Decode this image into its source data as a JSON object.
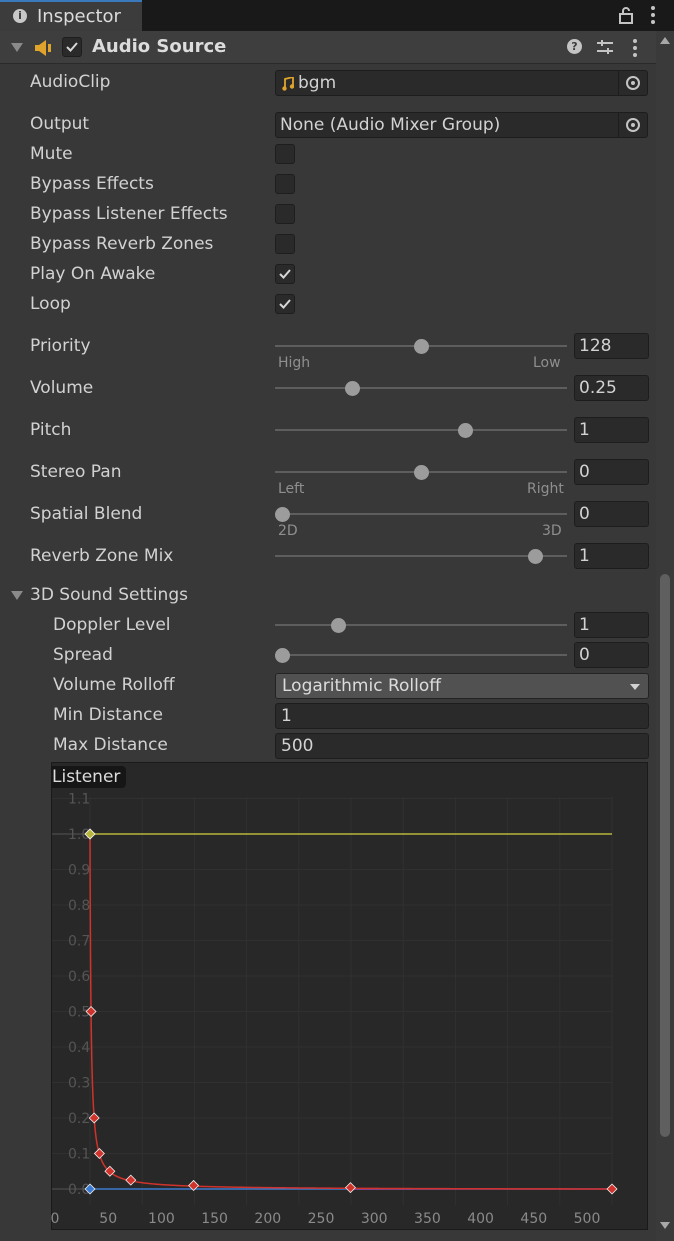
{
  "window": {
    "tab_title": "Inspector"
  },
  "component": {
    "title": "Audio Source",
    "enabled": true
  },
  "fields": {
    "audioclip": {
      "label": "AudioClip",
      "value": "bgm"
    },
    "output": {
      "label": "Output",
      "value": "None (Audio Mixer Group)"
    },
    "mute": {
      "label": "Mute",
      "checked": false
    },
    "bypass_effects": {
      "label": "Bypass Effects",
      "checked": false
    },
    "bypass_listener_effects": {
      "label": "Bypass Listener Effects",
      "checked": false
    },
    "bypass_reverb_zones": {
      "label": "Bypass Reverb Zones",
      "checked": false
    },
    "play_on_awake": {
      "label": "Play On Awake",
      "checked": true
    },
    "loop": {
      "label": "Loop",
      "checked": true
    }
  },
  "sliders": {
    "priority": {
      "label": "Priority",
      "value": "128",
      "fraction": 0.5,
      "left_caption": "High",
      "right_caption": "Low"
    },
    "volume": {
      "label": "Volume",
      "value": "0.25",
      "fraction": 0.25
    },
    "pitch": {
      "label": "Pitch",
      "value": "1",
      "fraction": 0.657
    },
    "stereo_pan": {
      "label": "Stereo Pan",
      "value": "0",
      "fraction": 0.5,
      "left_caption": "Left",
      "right_caption": "Right"
    },
    "spatial_blend": {
      "label": "Spatial Blend",
      "value": "0",
      "fraction": 0.0,
      "left_caption": "2D",
      "right_caption": "3D"
    },
    "reverb_zone_mix": {
      "label": "Reverb Zone Mix",
      "value": "1",
      "fraction": 0.9091
    }
  },
  "sound3d": {
    "title": "3D Sound Settings",
    "doppler_level": {
      "label": "Doppler Level",
      "value": "1",
      "fraction": 0.2
    },
    "spread": {
      "label": "Spread",
      "value": "0",
      "fraction": 0.0
    },
    "volume_rolloff": {
      "label": "Volume Rolloff",
      "value": "Logarithmic Rolloff"
    },
    "min_distance": {
      "label": "Min Distance",
      "value": "1"
    },
    "max_distance": {
      "label": "Max Distance",
      "value": "500"
    }
  },
  "curve": {
    "listener_label": "Listener",
    "y_ticks": [
      "0.0",
      "0.1",
      "0.2",
      "0.3",
      "0.4",
      "0.5",
      "0.6",
      "0.7",
      "0.8",
      "0.9",
      "1.0",
      "1.1"
    ],
    "x_ticks": [
      "0",
      "50",
      "100",
      "150",
      "200",
      "250",
      "300",
      "350",
      "400",
      "450",
      "500"
    ],
    "colors": {
      "volume": "#d0332b",
      "spatial": "#b8b63a",
      "spread": "#3a7ad0",
      "reverb": "#9c4fc2"
    },
    "chart_data": {
      "type": "line",
      "xlim": [
        0,
        500
      ],
      "ylim": [
        0,
        1.1
      ],
      "series": [
        {
          "x": [
            1,
            2,
            5,
            10,
            20,
            40,
            100,
            250,
            500
          ],
          "y": [
            1.0,
            0.5,
            0.2,
            0.1,
            0.05,
            0.025,
            0.01,
            0.004,
            0.0
          ]
        },
        {
          "x": [
            1,
            500
          ],
          "y": [
            1.0,
            1.0
          ]
        },
        {
          "x": [
            1,
            500
          ],
          "y": [
            0.0,
            0.0
          ]
        }
      ],
      "keys": [
        {
          "x": 1,
          "y": 1.0
        },
        {
          "x": 2,
          "y": 0.5
        },
        {
          "x": 5,
          "y": 0.2
        },
        {
          "x": 10,
          "y": 0.1
        },
        {
          "x": 20,
          "y": 0.05
        },
        {
          "x": 40,
          "y": 0.025
        },
        {
          "x": 100,
          "y": 0.01
        },
        {
          "x": 250,
          "y": 0.004
        },
        {
          "x": 500,
          "y": 0.0
        }
      ]
    }
  }
}
